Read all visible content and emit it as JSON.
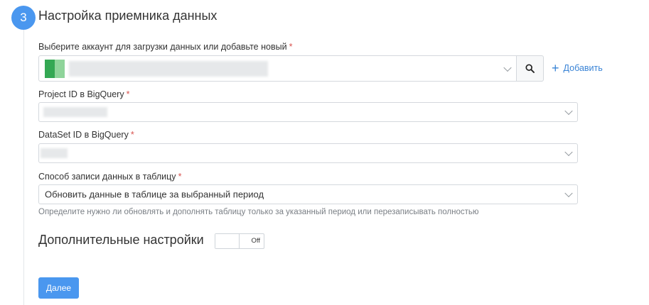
{
  "step": {
    "number": "3",
    "title": "Настройка приемника данных"
  },
  "account": {
    "label": "Выберите аккаунт для загрузки данных или добавьте новый",
    "required_mark": "*",
    "search_icon": "search-icon",
    "add_label": "Добавить",
    "add_icon": "plus-icon",
    "logo_colors": [
      "#34a853",
      "#8fd49a"
    ]
  },
  "project": {
    "label": "Project ID в BigQuery",
    "required_mark": "*"
  },
  "dataset": {
    "label": "DataSet ID в BigQuery",
    "required_mark": "*"
  },
  "write_mode": {
    "label": "Способ записи данных в таблицу",
    "required_mark": "*",
    "selected": "Обновить данные в таблице за выбранный период",
    "hint": "Определите нужно ли обновлять и дополнять таблицу только за указанный период или перезаписывать полностью"
  },
  "advanced": {
    "title": "Дополнительные настройки",
    "toggle_state": "Off"
  },
  "next_button": "Далее",
  "colors": {
    "accent": "#4a97ef",
    "link": "#3a84d6",
    "required": "#d9534f"
  }
}
